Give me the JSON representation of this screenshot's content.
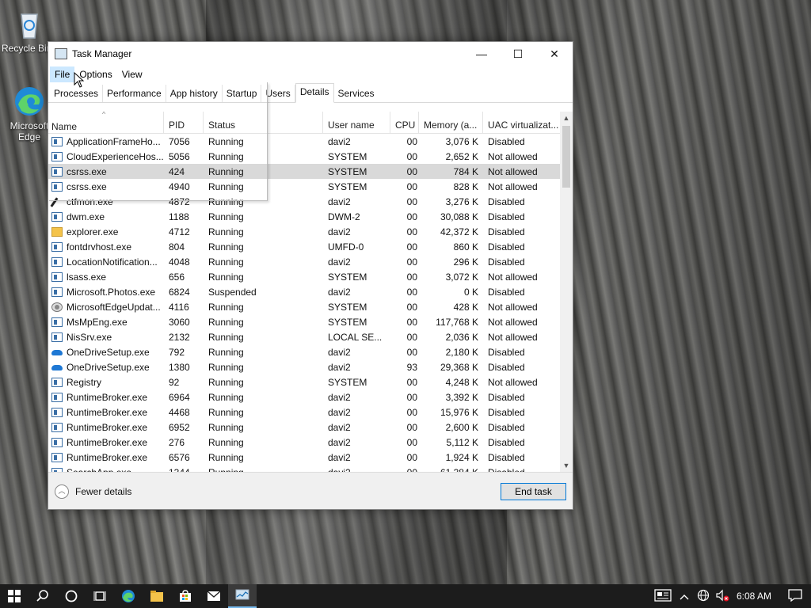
{
  "desktop": {
    "icons": [
      {
        "label": "Recycle Bin"
      },
      {
        "label": "Microsoft Edge"
      }
    ]
  },
  "window": {
    "title": "Task Manager",
    "controls": {
      "minimize": "—",
      "maximize": "☐",
      "close": "✕"
    },
    "menu": [
      "File",
      "Options",
      "View"
    ],
    "tabs": [
      "Processes",
      "Performance",
      "App history",
      "Startup",
      "Users",
      "Details",
      "Services"
    ],
    "selected_tab": "Details"
  },
  "table": {
    "columns": [
      "Name",
      "PID",
      "Status",
      "User name",
      "CPU",
      "Memory (a...",
      "UAC virtualizat..."
    ],
    "rows": [
      {
        "name": "ApplicationFrameHo...",
        "pid": "7056",
        "status": "Running",
        "user": "davi2",
        "cpu": "00",
        "mem": "3,076 K",
        "uac": "Disabled",
        "icon": "app"
      },
      {
        "name": "CloudExperienceHos...",
        "pid": "5056",
        "status": "Running",
        "user": "SYSTEM",
        "cpu": "00",
        "mem": "2,652 K",
        "uac": "Not allowed",
        "icon": "app"
      },
      {
        "name": "csrss.exe",
        "pid": "424",
        "status": "Running",
        "user": "SYSTEM",
        "cpu": "00",
        "mem": "784 K",
        "uac": "Not allowed",
        "icon": "app"
      },
      {
        "name": "csrss.exe",
        "pid": "4940",
        "status": "Running",
        "user": "SYSTEM",
        "cpu": "00",
        "mem": "828 K",
        "uac": "Not allowed",
        "icon": "app"
      },
      {
        "name": "ctfmon.exe",
        "pid": "4872",
        "status": "Running",
        "user": "davi2",
        "cpu": "00",
        "mem": "3,276 K",
        "uac": "Disabled",
        "icon": "pen"
      },
      {
        "name": "dwm.exe",
        "pid": "1188",
        "status": "Running",
        "user": "DWM-2",
        "cpu": "00",
        "mem": "30,088 K",
        "uac": "Disabled",
        "icon": "app"
      },
      {
        "name": "explorer.exe",
        "pid": "4712",
        "status": "Running",
        "user": "davi2",
        "cpu": "00",
        "mem": "42,372 K",
        "uac": "Disabled",
        "icon": "folder"
      },
      {
        "name": "fontdrvhost.exe",
        "pid": "804",
        "status": "Running",
        "user": "UMFD-0",
        "cpu": "00",
        "mem": "860 K",
        "uac": "Disabled",
        "icon": "app"
      },
      {
        "name": "LocationNotification...",
        "pid": "4048",
        "status": "Running",
        "user": "davi2",
        "cpu": "00",
        "mem": "296 K",
        "uac": "Disabled",
        "icon": "app"
      },
      {
        "name": "lsass.exe",
        "pid": "656",
        "status": "Running",
        "user": "SYSTEM",
        "cpu": "00",
        "mem": "3,072 K",
        "uac": "Not allowed",
        "icon": "app"
      },
      {
        "name": "Microsoft.Photos.exe",
        "pid": "6824",
        "status": "Suspended",
        "user": "davi2",
        "cpu": "00",
        "mem": "0 K",
        "uac": "Disabled",
        "icon": "app"
      },
      {
        "name": "MicrosoftEdgeUpdat...",
        "pid": "4116",
        "status": "Running",
        "user": "SYSTEM",
        "cpu": "00",
        "mem": "428 K",
        "uac": "Not allowed",
        "icon": "gear"
      },
      {
        "name": "MsMpEng.exe",
        "pid": "3060",
        "status": "Running",
        "user": "SYSTEM",
        "cpu": "00",
        "mem": "117,768 K",
        "uac": "Not allowed",
        "icon": "app"
      },
      {
        "name": "NisSrv.exe",
        "pid": "2132",
        "status": "Running",
        "user": "LOCAL SE...",
        "cpu": "00",
        "mem": "2,036 K",
        "uac": "Not allowed",
        "icon": "app"
      },
      {
        "name": "OneDriveSetup.exe",
        "pid": "792",
        "status": "Running",
        "user": "davi2",
        "cpu": "00",
        "mem": "2,180 K",
        "uac": "Disabled",
        "icon": "cloud"
      },
      {
        "name": "OneDriveSetup.exe",
        "pid": "1380",
        "status": "Running",
        "user": "davi2",
        "cpu": "93",
        "mem": "29,368 K",
        "uac": "Disabled",
        "icon": "cloud"
      },
      {
        "name": "Registry",
        "pid": "92",
        "status": "Running",
        "user": "SYSTEM",
        "cpu": "00",
        "mem": "4,248 K",
        "uac": "Not allowed",
        "icon": "app"
      },
      {
        "name": "RuntimeBroker.exe",
        "pid": "6964",
        "status": "Running",
        "user": "davi2",
        "cpu": "00",
        "mem": "3,392 K",
        "uac": "Disabled",
        "icon": "app"
      },
      {
        "name": "RuntimeBroker.exe",
        "pid": "4468",
        "status": "Running",
        "user": "davi2",
        "cpu": "00",
        "mem": "15,976 K",
        "uac": "Disabled",
        "icon": "app"
      },
      {
        "name": "RuntimeBroker.exe",
        "pid": "6952",
        "status": "Running",
        "user": "davi2",
        "cpu": "00",
        "mem": "2,600 K",
        "uac": "Disabled",
        "icon": "app"
      },
      {
        "name": "RuntimeBroker.exe",
        "pid": "276",
        "status": "Running",
        "user": "davi2",
        "cpu": "00",
        "mem": "5,112 K",
        "uac": "Disabled",
        "icon": "app"
      },
      {
        "name": "RuntimeBroker.exe",
        "pid": "6576",
        "status": "Running",
        "user": "davi2",
        "cpu": "00",
        "mem": "1,924 K",
        "uac": "Disabled",
        "icon": "app"
      },
      {
        "name": "SearchApp.exe",
        "pid": "1344",
        "status": "Running",
        "user": "davi2",
        "cpu": "00",
        "mem": "61,384 K",
        "uac": "Disabled",
        "icon": "app"
      }
    ],
    "highlighted_row": 2
  },
  "footer": {
    "fewer_details": "Fewer details",
    "end_task": "End task"
  },
  "taskbar": {
    "clock": "6:08 AM"
  },
  "colors": {
    "menu_active": "#cce8ff",
    "accent": "#0078d7",
    "taskbar": "#1c1c1c"
  }
}
